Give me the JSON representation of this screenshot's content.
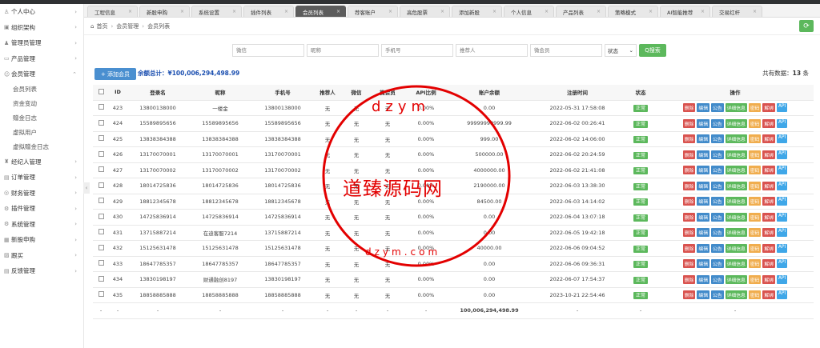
{
  "tabs": [
    {
      "label": "工程信息",
      "active": false
    },
    {
      "label": "新股申购",
      "active": false
    },
    {
      "label": "系统设置",
      "active": false
    },
    {
      "label": "插件列表",
      "active": false
    },
    {
      "label": "会员列表",
      "active": true
    },
    {
      "label": "荐客账户",
      "active": false
    },
    {
      "label": "高危股票",
      "active": false
    },
    {
      "label": "添加新股",
      "active": false
    },
    {
      "label": "个人信息",
      "active": false
    },
    {
      "label": "产品列表",
      "active": false
    },
    {
      "label": "策略模式",
      "active": false
    },
    {
      "label": "AI智能推荐",
      "active": false
    },
    {
      "label": "交易红杆",
      "active": false
    }
  ],
  "sidebar": {
    "items": [
      {
        "label": "个人中心",
        "icon": "person-icon"
      },
      {
        "label": "组织架构",
        "icon": "org-icon"
      },
      {
        "label": "管理员管理",
        "icon": "admin-icon"
      },
      {
        "label": "产品管理",
        "icon": "product-icon"
      },
      {
        "label": "会员管理",
        "icon": "member-icon"
      },
      {
        "label": "经纪人管理",
        "icon": "broker-icon"
      },
      {
        "label": "订单管理",
        "icon": "order-icon"
      },
      {
        "label": "财务管理",
        "icon": "finance-icon"
      },
      {
        "label": "插件管理",
        "icon": "plugin-icon"
      },
      {
        "label": "系统管理",
        "icon": "system-icon"
      },
      {
        "label": "新股申购",
        "icon": "ipo-icon"
      },
      {
        "label": "跟买",
        "icon": "follow-icon"
      },
      {
        "label": "反馈管理",
        "icon": "feedback-icon"
      }
    ],
    "sub_items": [
      "会员列表",
      "资金变动",
      "赠金日志",
      "虚拟用户",
      "虚拟赠金日志"
    ]
  },
  "breadcrumb": {
    "home": "首页",
    "section": "会员管理",
    "page": "会员列表"
  },
  "search": {
    "fields": [
      "微信",
      "昵称",
      "手机号",
      "推荐人",
      "微会员"
    ],
    "status_label": "状态",
    "search_btn": "Q搜索"
  },
  "toolbar": {
    "add_btn": "+ 添加会员",
    "balance_label": "余额总计：",
    "balance_value": "¥100,006,294,498.99",
    "total_label": "共有数据：",
    "total_value": "13",
    "total_unit": "条"
  },
  "table": {
    "headers": [
      "ID",
      "登录名",
      "昵称",
      "手机号",
      "推荐人",
      "微信",
      "微会员",
      "API比例",
      "账户余额",
      "注册时间",
      "状态",
      "操作"
    ],
    "rows": [
      [
        "423",
        "13800138000",
        "一楼金",
        "13800138000",
        "无",
        "无",
        "无",
        "0.00%",
        "0.00",
        "2022-05-31 17:58:08",
        "正常"
      ],
      [
        "424",
        "15589895656",
        "15589895656",
        "15589895656",
        "无",
        "无",
        "无",
        "0.00%",
        "99999999999.99",
        "2022-06-02 00:26:41",
        "正常"
      ],
      [
        "425",
        "13838384388",
        "13838384388",
        "13838384388",
        "无",
        "无",
        "无",
        "0.00%",
        "999.00",
        "2022-06-02 14:06:00",
        "正常"
      ],
      [
        "426",
        "13170070001",
        "13170070001",
        "13170070001",
        "无",
        "无",
        "无",
        "0.00%",
        "500000.00",
        "2022-06-02 20:24:59",
        "正常"
      ],
      [
        "427",
        "13170070002",
        "13170070002",
        "13170070002",
        "无",
        "无",
        "无",
        "0.00%",
        "4000000.00",
        "2022-06-02 21:41:08",
        "正常"
      ],
      [
        "428",
        "18014725836",
        "18014725836",
        "18014725836",
        "无",
        "无",
        "无",
        "0.00%",
        "2190000.00",
        "2022-06-03 13:38:30",
        "正常"
      ],
      [
        "429",
        "18812345678",
        "18812345678",
        "18812345678",
        "无",
        "无",
        "无",
        "0.00%",
        "84500.00",
        "2022-06-03 14:14:02",
        "正常"
      ],
      [
        "430",
        "14725836914",
        "14725836914",
        "14725836914",
        "无",
        "无",
        "无",
        "0.00%",
        "0.00",
        "2022-06-04 13:07:18",
        "正常"
      ],
      [
        "431",
        "13715887214",
        "在迪客服7214",
        "13715887214",
        "无",
        "无",
        "无",
        "0.00%",
        "0.00",
        "2022-06-05 19:42:18",
        "正常"
      ],
      [
        "432",
        "15125631478",
        "15125631478",
        "15125631478",
        "无",
        "无",
        "无",
        "0.00%",
        "40000.00",
        "2022-06-06 09:04:52",
        "正常"
      ],
      [
        "433",
        "18647785357",
        "18647785357",
        "18647785357",
        "无",
        "无",
        "无",
        "0.00%",
        "0.00",
        "2022-06-06 09:36:31",
        "正常"
      ],
      [
        "434",
        "13830198197",
        "财通融创8197",
        "13830198197",
        "无",
        "无",
        "无",
        "0.00%",
        "0.00",
        "2022-06-07 17:54:37",
        "正常"
      ],
      [
        "435",
        "18858885888",
        "18858885888",
        "18858885888",
        "无",
        "无",
        "无",
        "0.00%",
        "0.00",
        "2023-10-21 22:54:46",
        "正常"
      ]
    ],
    "footer": [
      "-",
      "-",
      "-",
      "-",
      "-",
      "-",
      "-",
      "-",
      "-",
      "100,006,294,498.99",
      "-",
      "-",
      "-"
    ],
    "ops": [
      {
        "label": "删除",
        "color": "red"
      },
      {
        "label": "编辑",
        "color": "blue"
      },
      {
        "label": "公告",
        "color": "blue"
      },
      {
        "label": "详细信息",
        "color": "green"
      },
      {
        "label": "密码",
        "color": "orange"
      },
      {
        "label": "解绑",
        "color": "red"
      },
      {
        "label": "API",
        "color": "cyan"
      }
    ]
  },
  "watermark": {
    "main": "道臻源码网",
    "ring_top": "dzym",
    "ring_bottom": "dzym.com"
  }
}
